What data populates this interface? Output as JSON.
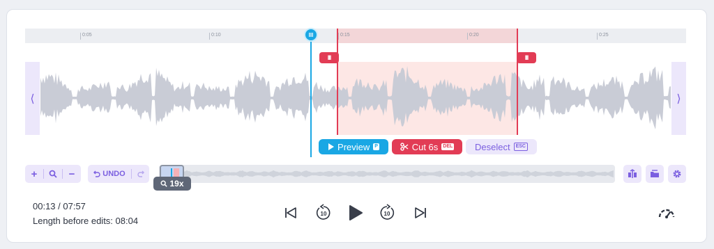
{
  "timeline": {
    "ticks": [
      "0:05",
      "0:10",
      "0:15",
      "0:20",
      "0:25"
    ]
  },
  "selection": {
    "preview_label": "Preview",
    "preview_key": "P",
    "cut_label": "Cut 6s",
    "cut_key": "DEL",
    "deselect_label": "Deselect",
    "deselect_key": "ESC"
  },
  "toolbar": {
    "undo_label": "UNDO",
    "zoom_label": "19x"
  },
  "status": {
    "time": "00:13 / 07:57",
    "length_before_edits": "Length before edits: 08:04"
  },
  "colors": {
    "accent": "#7b5fe0",
    "playhead": "#1aa7e4",
    "cut": "#e23c55",
    "waveform": "#c9ccd6"
  },
  "icons": {
    "zoom_in": "plus-icon",
    "zoom_search": "search-icon",
    "zoom_out": "minus-icon",
    "undo": "undo-icon",
    "redo": "redo-icon",
    "split": "split-icon",
    "folder": "folder-icon",
    "settings": "gear-icon",
    "skip_start": "skip-to-start-icon",
    "rewind": "rewind-10-icon",
    "play": "play-icon",
    "forward": "forward-10-icon",
    "skip_end": "skip-to-end-icon",
    "speed": "speedometer-icon"
  }
}
